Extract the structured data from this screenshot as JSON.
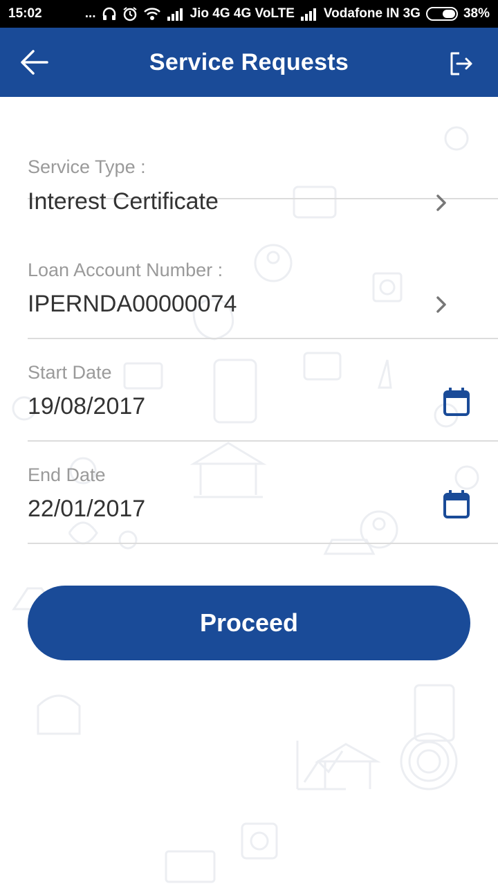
{
  "status_bar": {
    "time": "15:02",
    "dots": "...",
    "carrier1": "Jio 4G 4G VoLTE",
    "carrier2": "Vodafone IN 3G",
    "battery": "38%",
    "icons": [
      "headset-icon",
      "alarm-icon",
      "wifi-icon",
      "signal-icon",
      "battery-icon"
    ]
  },
  "app_bar": {
    "title": "Service Requests",
    "back_icon": "arrow-left-icon",
    "logout_icon": "logout-icon",
    "color": "#1a4b98"
  },
  "form": {
    "service_type": {
      "label": "Service Type :",
      "value": "Interest Certificate"
    },
    "loan_account": {
      "label": "Loan Account Number :",
      "value": "IPERNDA00000074"
    },
    "start_date": {
      "label": "Start Date",
      "value": "19/08/2017"
    },
    "end_date": {
      "label": "End Date",
      "value": "22/01/2017"
    }
  },
  "proceed_label": "Proceed"
}
